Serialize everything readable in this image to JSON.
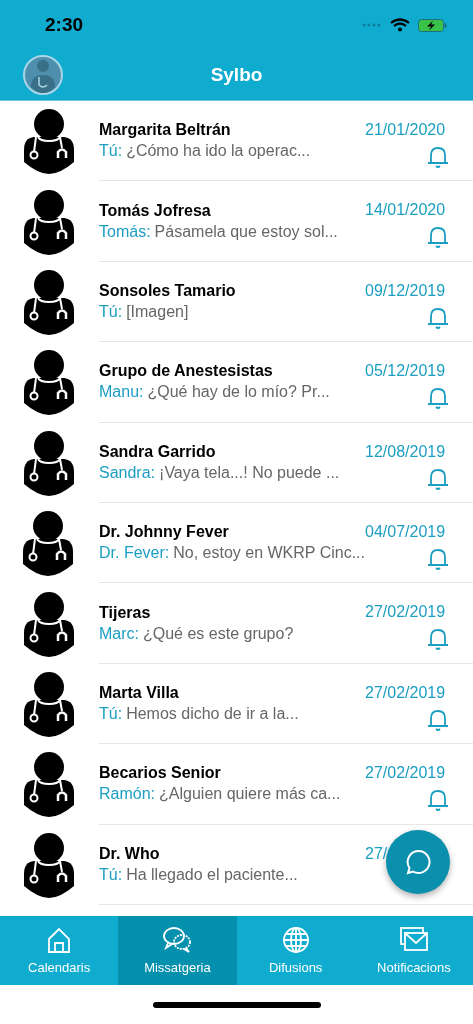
{
  "status_bar": {
    "time": "2:30"
  },
  "header": {
    "title": "Sylbo"
  },
  "chats": [
    {
      "name": "Margarita Beltrán",
      "sender": "Tú:",
      "preview": "¿Cómo ha ido la operac...",
      "date": "21/01/2020",
      "bell": true
    },
    {
      "name": "Tomás Jofresa",
      "sender": "Tomás:",
      "preview": "Pásamela que estoy sol...",
      "date": "14/01/2020",
      "bell": true
    },
    {
      "name": "Sonsoles Tamario",
      "sender": "Tú:",
      "preview": "[Imagen]",
      "date": "09/12/2019",
      "bell": true
    },
    {
      "name": "Grupo de Anestesistas",
      "sender": "Manu:",
      "preview": "¿Qué hay de lo mío? Pr...",
      "date": "05/12/2019",
      "bell": true
    },
    {
      "name": "Sandra Garrido",
      "sender": "Sandra:",
      "preview": "¡Vaya tela...! No puede ...",
      "date": "12/08/2019",
      "bell": true
    },
    {
      "name": "Dr. Johnny Fever",
      "sender": "Dr. Fever:",
      "preview": "No, estoy en WKRP Cinc...",
      "date": "04/07/2019",
      "bell": true
    },
    {
      "name": "Tijeras",
      "sender": "Marc:",
      "preview": "¿Qué es este grupo?",
      "date": "27/02/2019",
      "bell": true
    },
    {
      "name": "Marta Villa",
      "sender": "Tú:",
      "preview": "Hemos dicho de ir a la...",
      "date": "27/02/2019",
      "bell": true
    },
    {
      "name": "Becarios Senior",
      "sender": "Ramón:",
      "preview": "¿Alguien quiere más ca...",
      "date": "27/02/2019",
      "bell": true
    },
    {
      "name": "Dr. Who",
      "sender": "Tú:",
      "preview": "Ha llegado el paciente...",
      "date": "27/",
      "bell": false
    }
  ],
  "tabs": [
    {
      "label": "Calendaris",
      "kind": "home",
      "selected": false
    },
    {
      "label": "Missatgeria",
      "kind": "chat",
      "selected": true
    },
    {
      "label": "Difusions",
      "kind": "globe",
      "selected": false
    },
    {
      "label": "Notificacions",
      "kind": "mail",
      "selected": false
    }
  ]
}
